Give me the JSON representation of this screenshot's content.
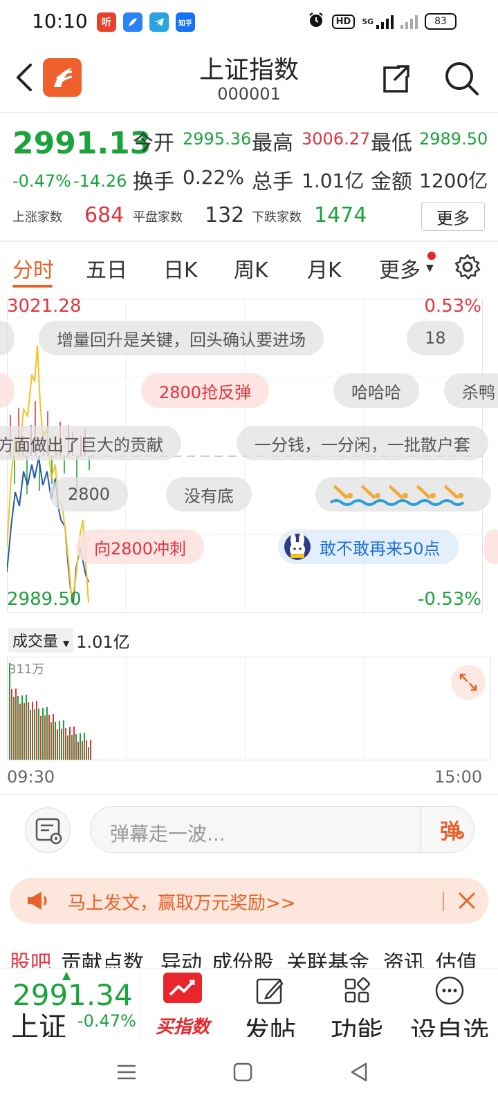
{
  "status_bar": {
    "time": "10:10",
    "app_icons": [
      "听",
      "知乎"
    ],
    "hd_label": "HD",
    "network": "5G",
    "battery": "83"
  },
  "header": {
    "title": "上证指数",
    "code": "000001"
  },
  "quote": {
    "price": "2991.13",
    "change_pct": "-0.47%",
    "change": "-14.26",
    "open_label": "今开",
    "open": "2995.36",
    "high_label": "最高",
    "high": "3006.27",
    "low_label": "最低",
    "low": "2989.50",
    "turnover_label": "换手",
    "turnover": "0.22%",
    "volume_label": "总手",
    "volume": "1.01亿",
    "amount_label": "金额",
    "amount": "1200亿",
    "up_label": "上涨家数",
    "up_count": "684",
    "flat_label": "平盘家数",
    "flat_count": "132",
    "down_label": "下跌家数",
    "down_count": "1474",
    "more_button": "更多"
  },
  "tabs": [
    "分时",
    "五日",
    "日K",
    "周K",
    "月K",
    "更多"
  ],
  "chart": {
    "top_price": "3021.28",
    "top_pct": "0.53%",
    "bottom_price": "2989.50",
    "bottom_pct": "-0.53%",
    "start_time": "09:30",
    "end_time": "15:00",
    "volume_selector": "成交量",
    "volume_total": "1.01亿",
    "volume_max": "311万",
    "colors": {
      "up": "#e3343e",
      "down": "#1aa33b",
      "price_line": "#2457a8",
      "avg_line": "#f2c31b",
      "accent": "#e8622a"
    }
  },
  "danmaku": [
    {
      "text": "增量回升是关键，回头确认要进场",
      "style": "gray"
    },
    {
      "text": "18",
      "style": "gray"
    },
    {
      "text": "2800抢反弹",
      "style": "pink"
    },
    {
      "text": "哈哈哈",
      "style": "gray"
    },
    {
      "text": "杀鸭",
      "style": "gray"
    },
    {
      "text": "方面做出了巨大的贡献",
      "style": "gray"
    },
    {
      "text": "一分钱，一分闲，一批散户套",
      "style": "gray"
    },
    {
      "text": "2800",
      "style": "gray"
    },
    {
      "text": "没有底",
      "style": "gray"
    },
    {
      "text": "向2800冲刺",
      "style": "pink"
    },
    {
      "text": "敢不敢再来50点",
      "style": "blue"
    }
  ],
  "comment_bar": {
    "placeholder": "弹幕走一波...",
    "send_label": "弹"
  },
  "promo": {
    "text": "马上发文，赢取万元奖励>>"
  },
  "sub_tabs": [
    "股吧",
    "贡献点数",
    "异动",
    "成份股",
    "关联基金",
    "资讯",
    "估值"
  ],
  "bottom_bar": {
    "price": "2991.34",
    "name": "上证",
    "change_pct": "-0.47%",
    "buy_label": "买指数",
    "post_label": "发帖",
    "function_label": "功能",
    "watchlist_label": "设自选"
  }
}
